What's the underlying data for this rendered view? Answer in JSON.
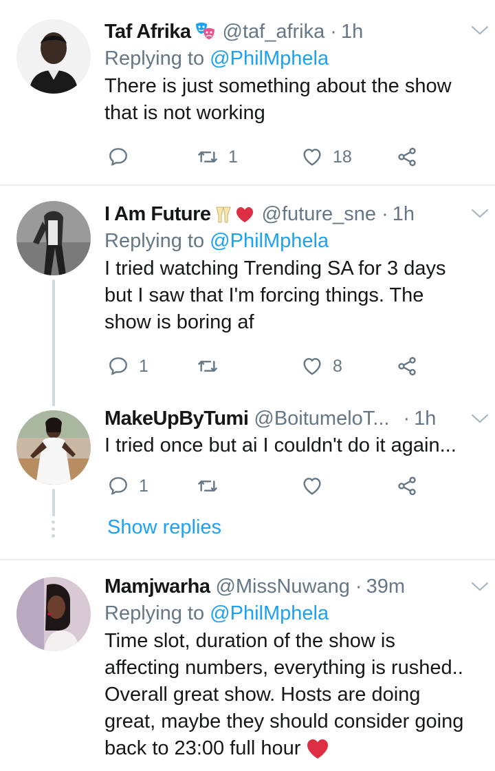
{
  "tweets": [
    {
      "name": "Taf Afrika",
      "name_emoji": "theater-masks-emoji",
      "handle": "@taf_afrika",
      "time": "1h",
      "replying_label": "Replying to",
      "replying_to": "@PhilMphela",
      "text_lines": [
        "There is just something about the show",
        "that is not working"
      ],
      "reply_count": "",
      "retweet_count": "1",
      "like_count": "18"
    },
    {
      "name": "I Am Future",
      "name_emoji": "clinking-glasses-and-red-heart-emoji",
      "handle": "@future_sne",
      "time": "1h",
      "replying_label": "Replying to",
      "replying_to": "@PhilMphela",
      "text_lines": [
        "I tried watching Trending SA for 3 days",
        "but I saw that I'm forcing things. The",
        "show is boring af"
      ],
      "reply_count": "1",
      "retweet_count": "",
      "like_count": "8"
    },
    {
      "name": "MakeUpByTumi",
      "handle": "@BoitumeloT...",
      "time": "1h",
      "text_lines": [
        "I tried once but ai I couldn't do it again..."
      ],
      "reply_count": "1",
      "retweet_count": "",
      "like_count": ""
    },
    {
      "name": "Mamjwarha",
      "handle": "@MissNuwang",
      "time": "39m",
      "replying_label": "Replying to",
      "replying_to": "@PhilMphela",
      "text_lines": [
        "Time slot, duration of the show is",
        "affecting numbers, everything is rushed..",
        "Overall great show. Hosts are doing",
        "great, maybe they should consider going",
        "back to 23:00 full hour"
      ],
      "text_trailing_emoji": "red-heart-emoji"
    }
  ],
  "show_replies": "Show replies",
  "separator": "·",
  "colors": {
    "link": "#1da1f2",
    "secondary": "#657786",
    "primary_text": "#14171a",
    "divider": "#e6ecf0",
    "heart": "#e0245e"
  },
  "icons": {
    "reply": "reply-icon",
    "retweet": "retweet-icon",
    "like": "heart-outline-icon",
    "share": "share-icon",
    "menu": "chevron-down-icon"
  }
}
